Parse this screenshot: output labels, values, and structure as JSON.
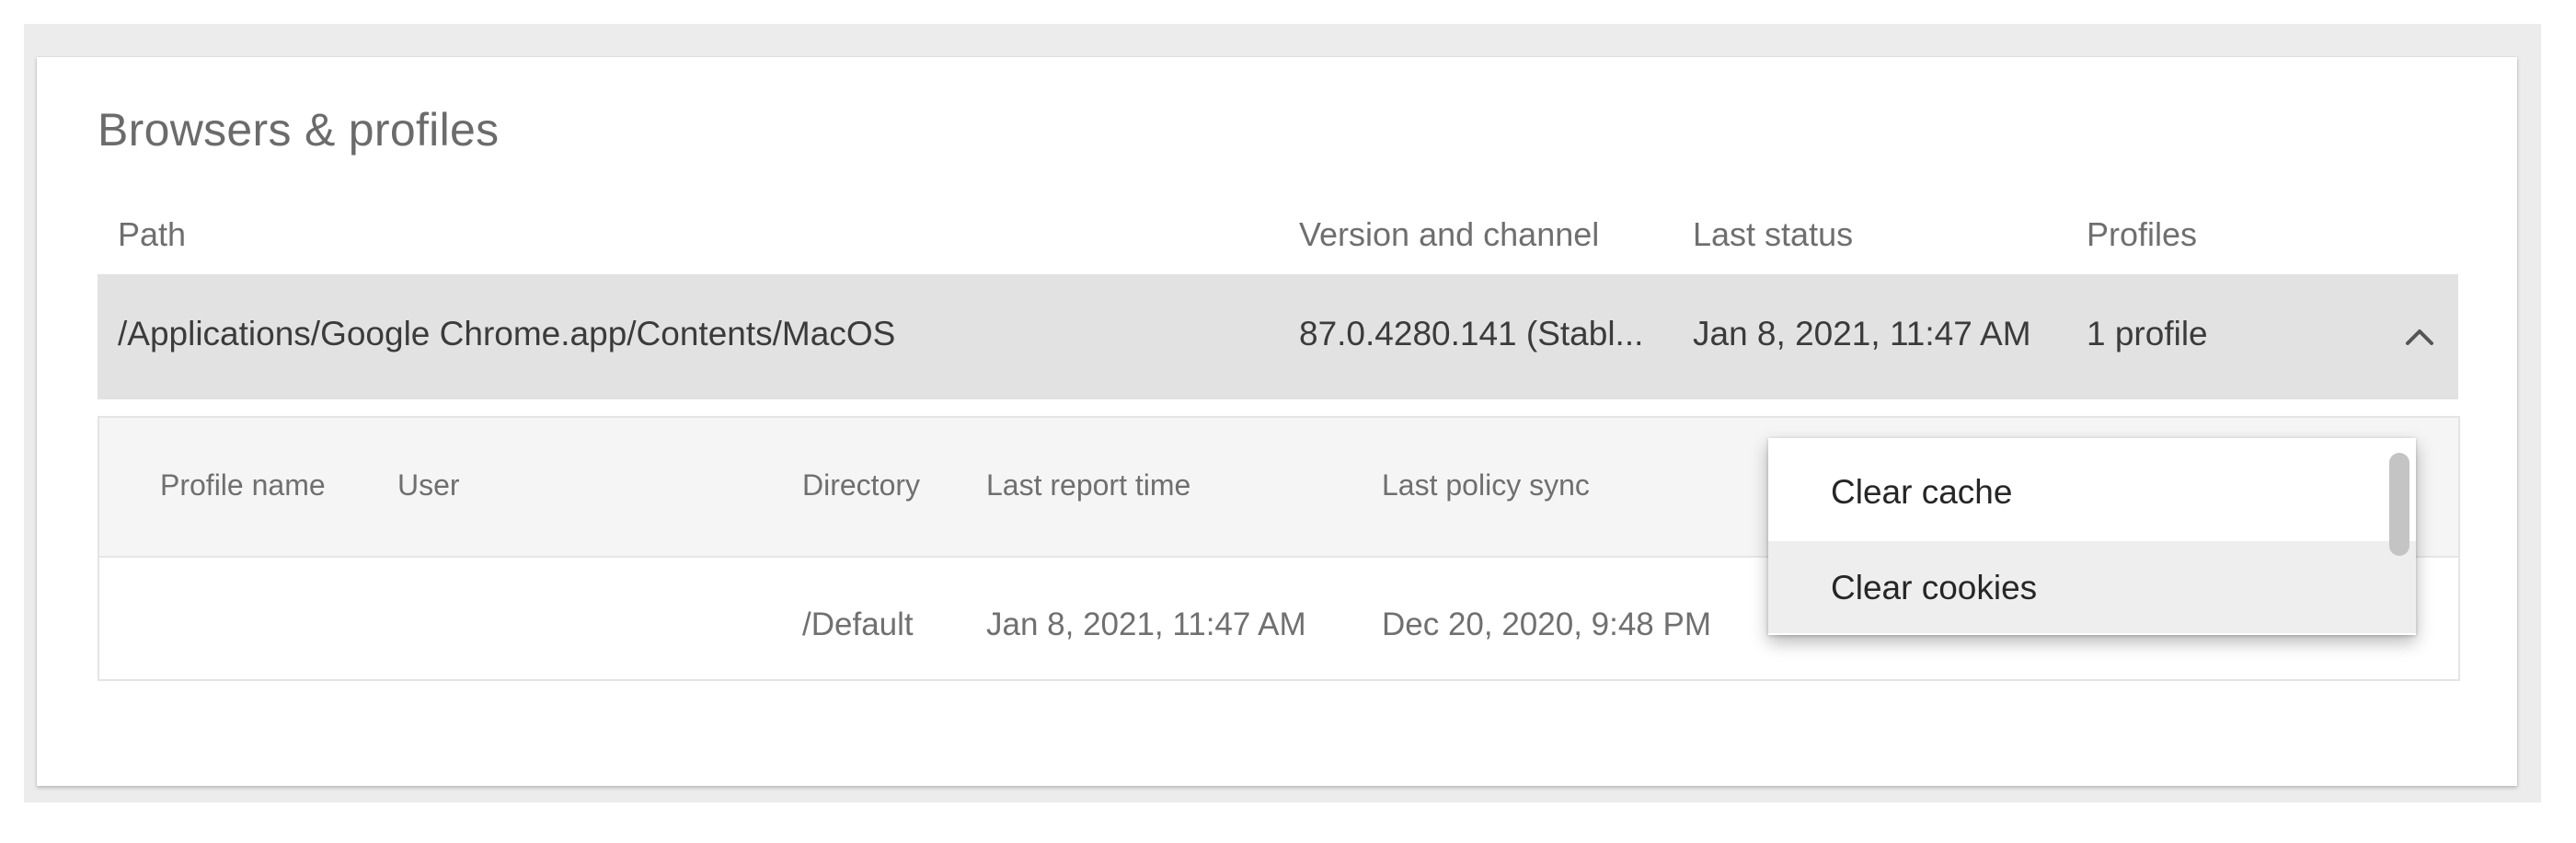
{
  "section": {
    "title": "Browsers & profiles"
  },
  "columns": {
    "path": "Path",
    "version": "Version and channel",
    "last_status": "Last status",
    "profiles": "Profiles"
  },
  "browser_row": {
    "path": "/Applications/Google Chrome.app/Contents/MacOS",
    "version": "87.0.4280.141 (Stabl...",
    "last_status": "Jan 8, 2021, 11:47 AM",
    "profiles": "1 profile",
    "expand_icon": "chevron-up-icon"
  },
  "profile_table": {
    "columns": {
      "profile_name": "Profile name",
      "user": "User",
      "directory": "Directory",
      "last_report_time": "Last report time",
      "last_policy_sync": "Last policy sync"
    },
    "rows": [
      {
        "profile_name": "",
        "user": "",
        "directory": "/Default",
        "last_report_time": "Jan 8, 2021, 11:47 AM",
        "last_policy_sync": "Dec 20, 2020, 9:48 PM"
      }
    ]
  },
  "menu": {
    "items": [
      {
        "label": "Clear cache"
      },
      {
        "label": "Clear cookies"
      }
    ]
  },
  "colors": {
    "row_highlight": "#e2e2e2",
    "subheader_bg": "#f5f5f5",
    "menu_hover": "#eeeeee"
  }
}
